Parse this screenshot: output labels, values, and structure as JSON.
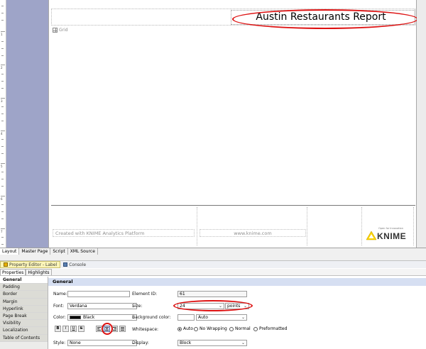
{
  "report": {
    "title": "Austin Restaurants Report",
    "grid_label": "Grid",
    "footer_created": "Created with KNIME Analytics Platform",
    "footer_url": "www.knime.com",
    "logo": {
      "tagline": "Open for Innovation",
      "wordmark": "KNIME"
    }
  },
  "ruler": {
    "marks": [
      "1",
      "2",
      "3",
      "4",
      "5",
      "6",
      "7"
    ]
  },
  "layout_tabs": [
    {
      "label": "Layout",
      "active": true
    },
    {
      "label": "Master Page",
      "active": false
    },
    {
      "label": "Script",
      "active": false
    },
    {
      "label": "XML Source",
      "active": false
    }
  ],
  "panels": {
    "property_editor": "Property Editor - Label",
    "console": "Console"
  },
  "prop_tabs": [
    {
      "label": "Properties",
      "active": true
    },
    {
      "label": "Highlights",
      "active": false
    }
  ],
  "categories": [
    "General",
    "Padding",
    "Border",
    "Margin",
    "Hyperlink",
    "Page Break",
    "Visibility",
    "Localization",
    "Table of Contents"
  ],
  "general": {
    "section_title": "General",
    "name_label": "Name:",
    "name_value": "",
    "element_id_label": "Element ID:",
    "element_id_value": "61",
    "font_label": "Font:",
    "font_value": "Verdana",
    "size_label": "Size:",
    "size_value": "24",
    "size_unit": "points",
    "color_label": "Color:",
    "color_value": "Black",
    "bg_color_label": "Background color:",
    "bg_color_value": "Auto",
    "whitespace_label": "Whitespace:",
    "whitespace_options": [
      "Auto",
      "No Wrapping",
      "Normal",
      "Preformatted"
    ],
    "whitespace_selected": "Auto",
    "style_label": "Style:",
    "style_value": "None",
    "display_label": "Display:",
    "display_value": "Block",
    "format_buttons": [
      "B",
      "I",
      "U",
      "S"
    ]
  },
  "colors": {
    "annotation": "#dd1111",
    "margin_band": "#9ea4c8",
    "section_header": "#d6dff2",
    "knime_yellow": "#ffd500"
  }
}
